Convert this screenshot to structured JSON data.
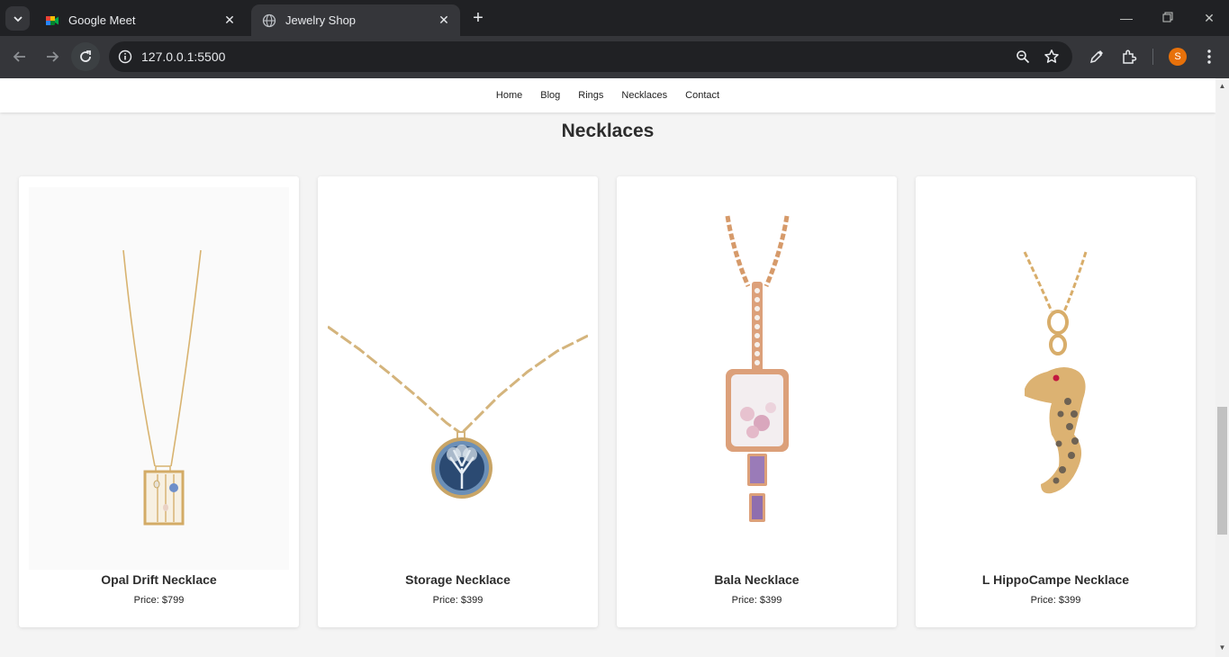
{
  "browser": {
    "tabs": [
      {
        "title": "Google Meet",
        "active": false
      },
      {
        "title": "Jewelry Shop",
        "active": true
      }
    ],
    "url": "127.0.0.1:5500",
    "profile_initial": "S"
  },
  "site": {
    "nav": [
      "Home",
      "Blog",
      "Rings",
      "Necklaces",
      "Contact"
    ],
    "heading": "Necklaces",
    "products": [
      {
        "name": "Opal Drift Necklace",
        "price": "Price: $799"
      },
      {
        "name": "Storage Necklace",
        "price": "Price: $399"
      },
      {
        "name": "Bala Necklace",
        "price": "Price: $399"
      },
      {
        "name": "L HippoCampe Necklace",
        "price": "Price: $399"
      }
    ]
  },
  "colors": {
    "chrome_dark": "#202124",
    "chrome_toolbar": "#35363a",
    "page_bg": "#f4f4f4",
    "gold": "#d9b06a",
    "profile": "#e8710a"
  }
}
